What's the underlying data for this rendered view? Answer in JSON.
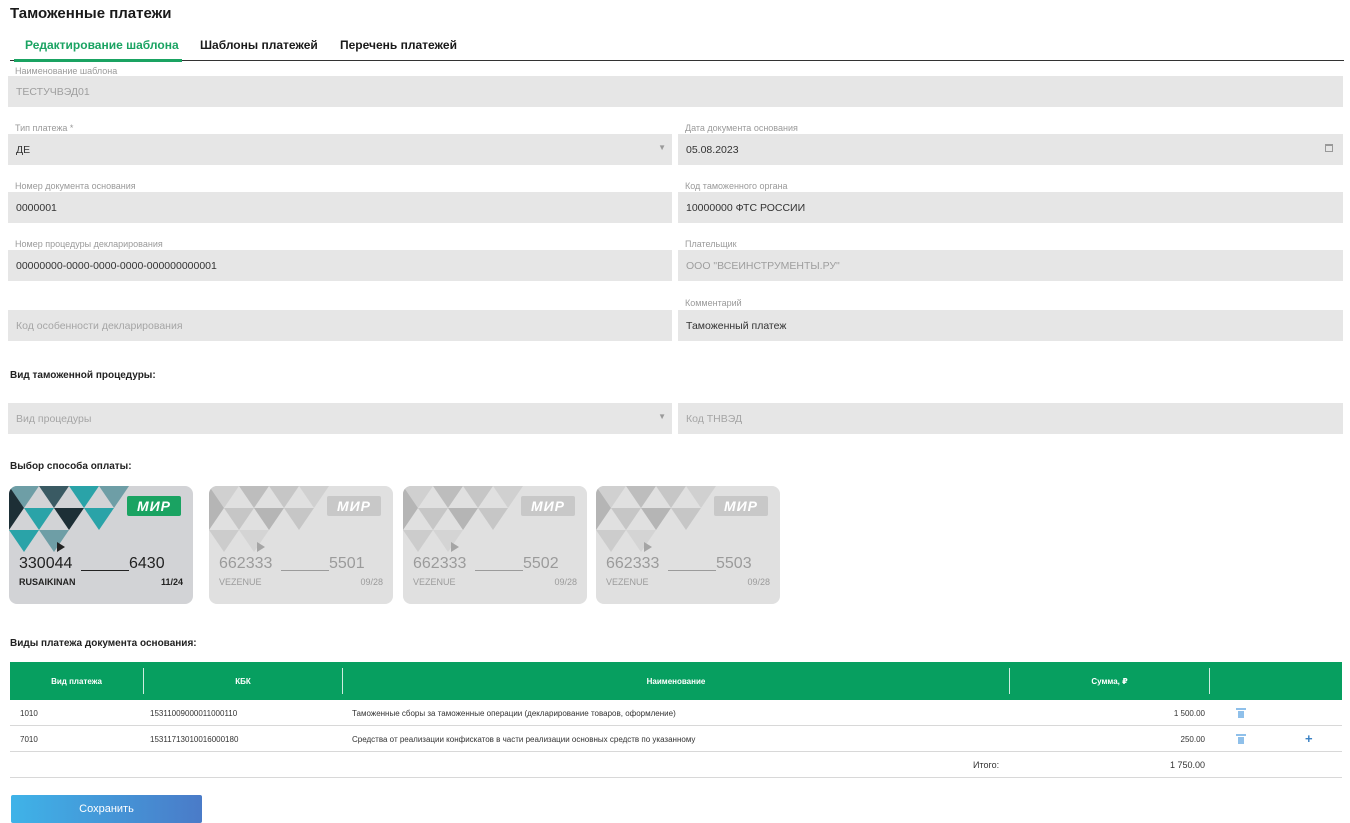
{
  "page": {
    "title": "Таможенные платежи"
  },
  "tabs": [
    {
      "label": "Редактирование шаблона",
      "active": true
    },
    {
      "label": "Шаблоны платежей",
      "active": false
    },
    {
      "label": "Перечень платежей",
      "active": false
    }
  ],
  "form": {
    "template_name": {
      "label": "Наименование шаблона",
      "value": "ТЕСТУЧВЭД01"
    },
    "payment_type": {
      "label": "Тип платежа *",
      "value": "ДЕ"
    },
    "doc_date": {
      "label": "Дата документа основания",
      "value": "05.08.2023"
    },
    "doc_number": {
      "label": "Номер документа основания",
      "value": "0000001"
    },
    "customs_code": {
      "label": "Код таможенного органа",
      "value": "10000000 ФТС РОССИИ"
    },
    "procedure_number": {
      "label": "Номер процедуры декларирования",
      "value": "00000000-0000-0000-0000-000000000001"
    },
    "payer": {
      "label": "Плательщик",
      "value": "ООО \"ВСЕИНСТРУМЕНТЫ.РУ\""
    },
    "feature_code": {
      "placeholder": "Код особенности декларирования"
    },
    "comment": {
      "label": "Комментарий",
      "value": "Таможенный платеж"
    }
  },
  "procedure_section": {
    "title": "Вид таможенной процедуры:",
    "procedure_type_placeholder": "Вид процедуры",
    "tnved_placeholder": "Код ТНВЭД"
  },
  "payment_section": {
    "title": "Выбор способа оплаты:",
    "cards": [
      {
        "brand": "МИР",
        "prefix": "330044",
        "suffix": "6430",
        "holder": "RUSAIKINAN",
        "expiry": "11/24",
        "selected": true
      },
      {
        "brand": "МИР",
        "prefix": "662333",
        "suffix": "5501",
        "holder": "VEZENUE",
        "expiry": "09/28",
        "selected": false
      },
      {
        "brand": "МИР",
        "prefix": "662333",
        "suffix": "5502",
        "holder": "VEZENUE",
        "expiry": "09/28",
        "selected": false
      },
      {
        "brand": "МИР",
        "prefix": "662333",
        "suffix": "5503",
        "holder": "VEZENUE",
        "expiry": "09/28",
        "selected": false
      }
    ]
  },
  "payments_table": {
    "title": "Виды платежа документа основания:",
    "headers": {
      "type": "Вид платежа",
      "kbk": "КБК",
      "name": "Наименование",
      "sum": "Сумма, ₽"
    },
    "rows": [
      {
        "type": "1010",
        "kbk": "15311009000011000110",
        "name": "Таможенные сборы за таможенные операции (декларирование товаров, оформление)",
        "sum": "1 500.00"
      },
      {
        "type": "7010",
        "kbk": "15311713010016000180",
        "name": "Средства от реализации конфискатов в части реализации основных средств по указанному",
        "sum": "250.00"
      }
    ],
    "total_label": "Итого:",
    "total_value": "1 750.00"
  },
  "actions": {
    "save_label": "Сохранить"
  },
  "colors": {
    "accent": "#1aa362",
    "table_header": "#079f60",
    "field_bg": "#e6e6e6",
    "mir_active": "#1aa362",
    "mir_inactive": "#c8c8c8"
  },
  "icons": {
    "calendar": "calendar-icon",
    "dropdown": "chevron-down-icon",
    "delete": "trash-icon",
    "add": "plus-icon"
  }
}
